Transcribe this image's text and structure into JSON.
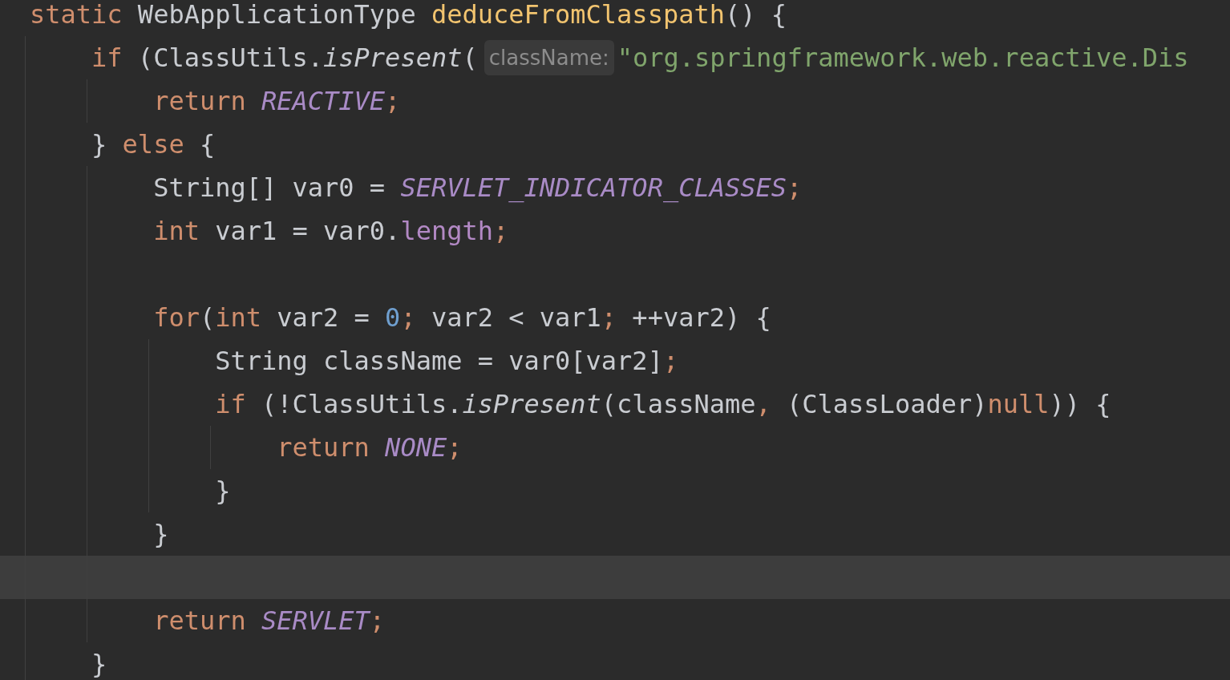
{
  "editor": {
    "lines": [
      {
        "current": false,
        "tokens": [
          {
            "kind": "keyword",
            "text": "static"
          },
          {
            "kind": "plain",
            "text": " WebApplicationType "
          },
          {
            "kind": "method",
            "text": "deduceFromClasspath"
          },
          {
            "kind": "plain",
            "text": "() {"
          }
        ]
      },
      {
        "current": false,
        "tokens": [
          {
            "kind": "guide"
          },
          {
            "kind": "keyword",
            "text": "if"
          },
          {
            "kind": "plain",
            "text": " (ClassUtils."
          },
          {
            "kind": "call",
            "text": "isPresent"
          },
          {
            "kind": "plain",
            "text": "("
          },
          {
            "kind": "hint",
            "text": "className:"
          },
          {
            "kind": "string",
            "text": "\"org.springframework.web.reactive.Dis"
          }
        ]
      },
      {
        "current": false,
        "tokens": [
          {
            "kind": "guide"
          },
          {
            "kind": "guide"
          },
          {
            "kind": "keyword",
            "text": "return "
          },
          {
            "kind": "constant",
            "text": "REACTIVE"
          },
          {
            "kind": "punct",
            "text": ";"
          }
        ]
      },
      {
        "current": false,
        "tokens": [
          {
            "kind": "guide"
          },
          {
            "kind": "plain",
            "text": "} "
          },
          {
            "kind": "keyword",
            "text": "else"
          },
          {
            "kind": "plain",
            "text": " {"
          }
        ]
      },
      {
        "current": false,
        "tokens": [
          {
            "kind": "guide"
          },
          {
            "kind": "guide"
          },
          {
            "kind": "plain",
            "text": "String[] var0 = "
          },
          {
            "kind": "constant",
            "text": "SERVLET_INDICATOR_CLASSES"
          },
          {
            "kind": "punct",
            "text": ";"
          }
        ]
      },
      {
        "current": false,
        "tokens": [
          {
            "kind": "guide"
          },
          {
            "kind": "guide"
          },
          {
            "kind": "keyword",
            "text": "int"
          },
          {
            "kind": "plain",
            "text": " var1 = var0."
          },
          {
            "kind": "field",
            "text": "length"
          },
          {
            "kind": "punct",
            "text": ";"
          }
        ]
      },
      {
        "tokens": [
          {
            "kind": "guide"
          },
          {
            "kind": "guide"
          }
        ]
      },
      {
        "current": false,
        "tokens": [
          {
            "kind": "guide"
          },
          {
            "kind": "guide"
          },
          {
            "kind": "keyword",
            "text": "for"
          },
          {
            "kind": "plain",
            "text": "("
          },
          {
            "kind": "keyword",
            "text": "int"
          },
          {
            "kind": "plain",
            "text": " var2 = "
          },
          {
            "kind": "number",
            "text": "0"
          },
          {
            "kind": "punct",
            "text": ";"
          },
          {
            "kind": "plain",
            "text": " var2 < var1"
          },
          {
            "kind": "punct",
            "text": ";"
          },
          {
            "kind": "plain",
            "text": " ++var2) {"
          }
        ]
      },
      {
        "current": false,
        "tokens": [
          {
            "kind": "guide"
          },
          {
            "kind": "guide"
          },
          {
            "kind": "guide"
          },
          {
            "kind": "plain",
            "text": "String className = var0[var2]"
          },
          {
            "kind": "punct",
            "text": ";"
          }
        ]
      },
      {
        "current": false,
        "tokens": [
          {
            "kind": "guide"
          },
          {
            "kind": "guide"
          },
          {
            "kind": "guide"
          },
          {
            "kind": "keyword",
            "text": "if"
          },
          {
            "kind": "plain",
            "text": " (!ClassUtils."
          },
          {
            "kind": "call",
            "text": "isPresent"
          },
          {
            "kind": "plain",
            "text": "(className"
          },
          {
            "kind": "punct",
            "text": ","
          },
          {
            "kind": "plain",
            "text": " (ClassLoader)"
          },
          {
            "kind": "keyword",
            "text": "null"
          },
          {
            "kind": "plain",
            "text": ")) {"
          }
        ]
      },
      {
        "current": false,
        "tokens": [
          {
            "kind": "guide"
          },
          {
            "kind": "guide"
          },
          {
            "kind": "guide"
          },
          {
            "kind": "guide"
          },
          {
            "kind": "keyword",
            "text": "return "
          },
          {
            "kind": "constant",
            "text": "NONE"
          },
          {
            "kind": "punct",
            "text": ";"
          }
        ]
      },
      {
        "current": false,
        "tokens": [
          {
            "kind": "guide"
          },
          {
            "kind": "guide"
          },
          {
            "kind": "guide"
          },
          {
            "kind": "plain",
            "text": "}"
          }
        ]
      },
      {
        "current": false,
        "tokens": [
          {
            "kind": "guide"
          },
          {
            "kind": "guide"
          },
          {
            "kind": "plain",
            "text": "}"
          }
        ]
      },
      {
        "current": true,
        "tokens": [
          {
            "kind": "guide"
          },
          {
            "kind": "guide"
          }
        ]
      },
      {
        "current": false,
        "tokens": [
          {
            "kind": "guide"
          },
          {
            "kind": "guide"
          },
          {
            "kind": "keyword",
            "text": "return "
          },
          {
            "kind": "constant",
            "text": "SERVLET"
          },
          {
            "kind": "punct",
            "text": ";"
          }
        ]
      },
      {
        "current": false,
        "tokens": [
          {
            "kind": "guide"
          },
          {
            "kind": "plain",
            "text": "}"
          }
        ]
      }
    ]
  }
}
